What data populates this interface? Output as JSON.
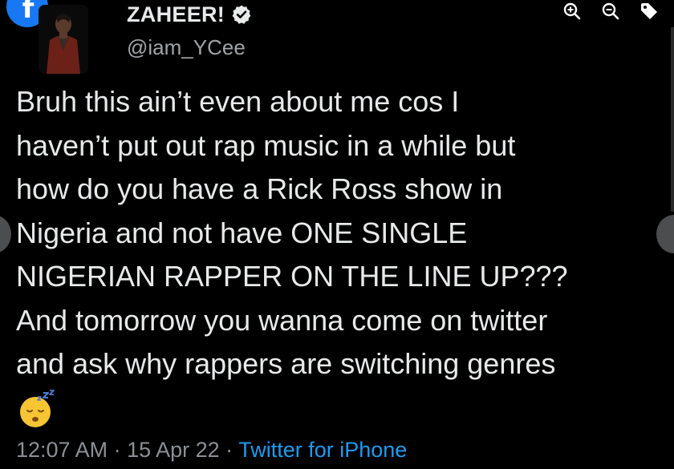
{
  "app": {
    "icons": [
      "facebook-icon",
      "zoom-in-icon",
      "zoom-out-icon",
      "tag-icon",
      "verified-badge-icon"
    ]
  },
  "tweet": {
    "display_name": "ZAHEER!",
    "handle": "@iam_YCee",
    "text": "Bruh this ain’t even about me cos I\nhaven’t put out rap music in a while but\nhow do you have a Rick Ross show in\nNigeria and not have ONE SINGLE\nNIGERIAN RAPPER ON THE LINE UP???\nAnd tomorrow you wanna come on twitter\nand ask why rappers are switching genres",
    "emoji": "sleeping-face",
    "time": "12:07 AM",
    "separator": " · ",
    "date": "15 Apr 22",
    "source": "Twitter for iPhone"
  },
  "colors": {
    "background": "#000000",
    "text": "#e7e9ea",
    "muted": "#8b9096",
    "link": "#1d9bf0",
    "facebook": "#1877f2"
  }
}
